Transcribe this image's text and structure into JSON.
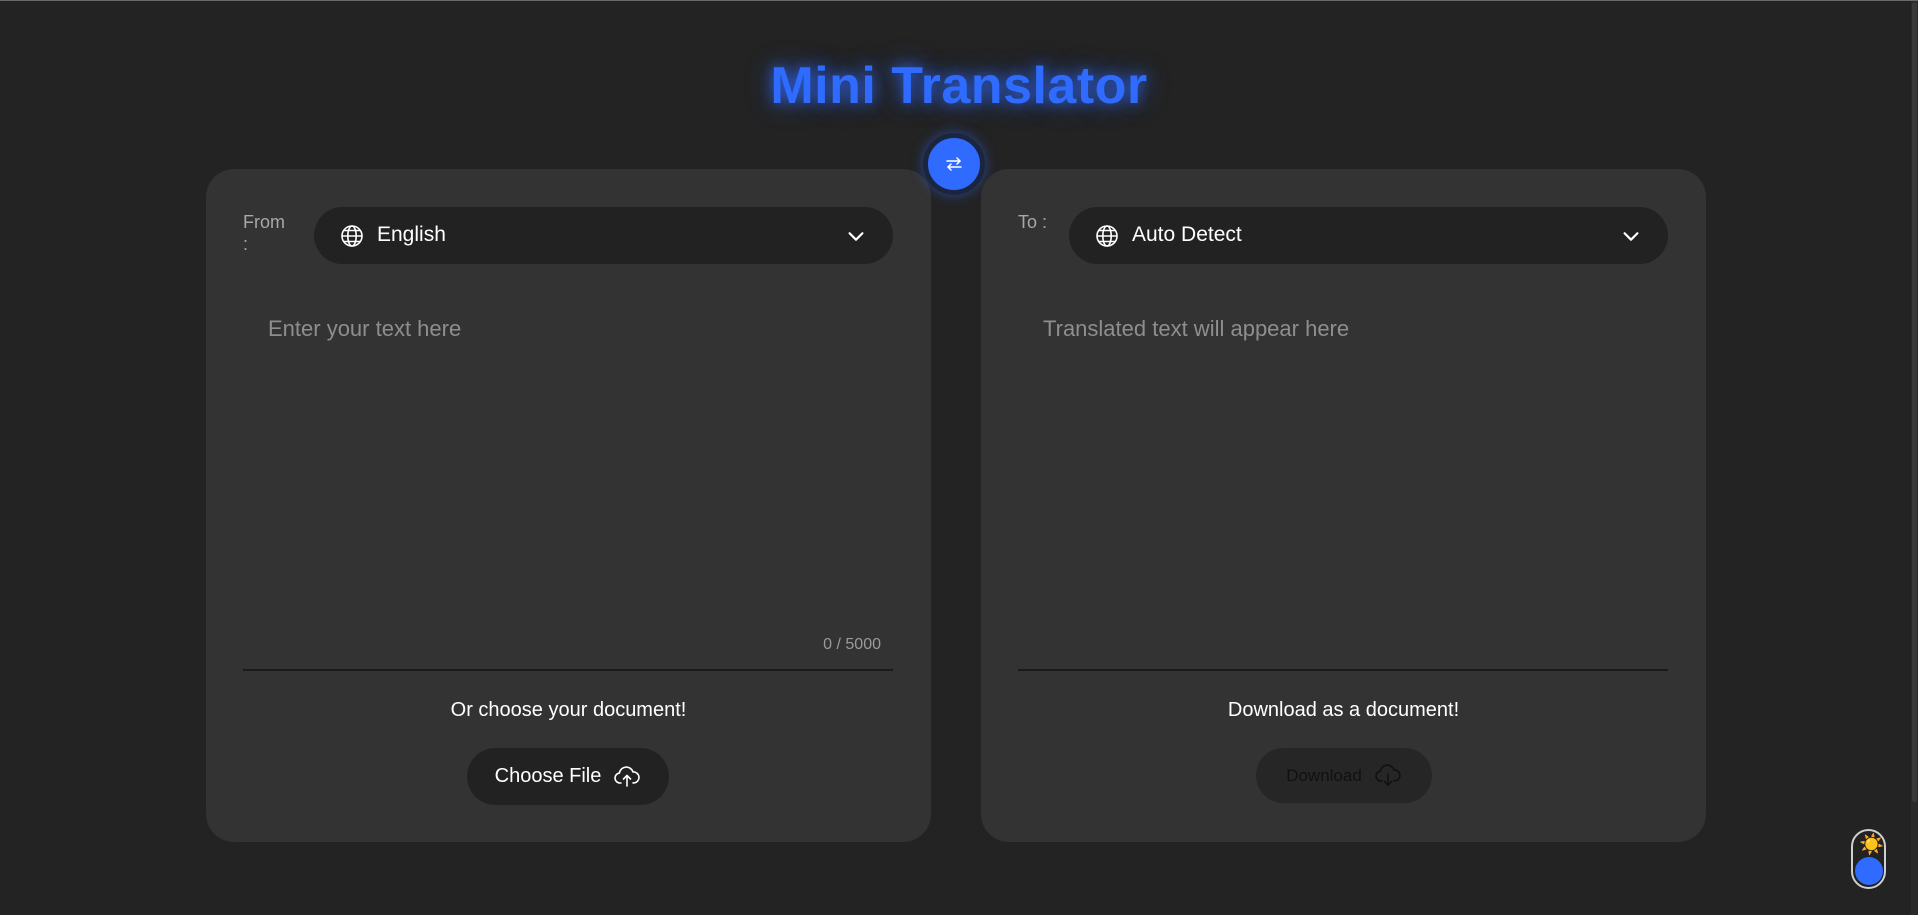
{
  "app": {
    "title": "Mini Translator"
  },
  "source": {
    "label": "From :",
    "language": "English",
    "placeholder": "Enter your text here",
    "char_count": "0 / 5000",
    "helper": "Or choose your document!",
    "button_label": "Choose File"
  },
  "target": {
    "label": "To :",
    "language": "Auto Detect",
    "placeholder": "Translated text will appear here",
    "helper": "Download as a document!",
    "button_label": "Download"
  },
  "icons": {
    "swap": "swap-arrows-icon",
    "globe": "globe-icon",
    "chevron": "chevron-down-icon",
    "upload": "cloud-upload-icon",
    "download": "cloud-download-icon",
    "theme": "sun-icon"
  },
  "colors": {
    "accent": "#2f6bff",
    "background": "#232323",
    "panel": "#333333",
    "control": "#222222"
  }
}
